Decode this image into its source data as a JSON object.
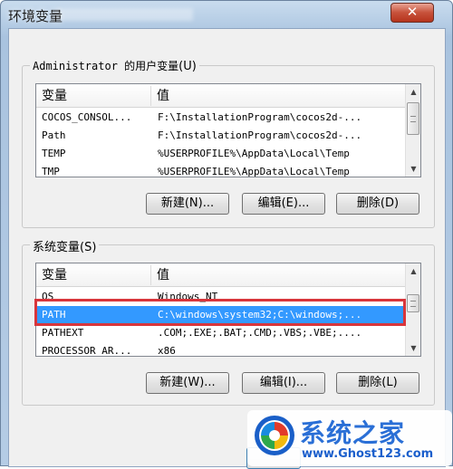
{
  "window": {
    "title": "环境变量",
    "close_label": "✕"
  },
  "user_vars": {
    "label": "Administrator 的用户变量",
    "label_key": "(U)",
    "col_var": "变量",
    "col_val": "值",
    "rows": [
      {
        "name": "COCOS_CONSOL...",
        "value": "F:\\InstallationProgram\\cocos2d-..."
      },
      {
        "name": "Path",
        "value": "F:\\InstallationProgram\\cocos2d-..."
      },
      {
        "name": "TEMP",
        "value": "%USERPROFILE%\\AppData\\Local\\Temp"
      },
      {
        "name": "TMP",
        "value": "%USERPROFILE%\\AppData\\Local\\Temp"
      }
    ],
    "buttons": {
      "new": "新建(N)...",
      "edit": "编辑(E)...",
      "delete": "删除(D)"
    }
  },
  "system_vars": {
    "label": "系统变量",
    "label_key": "(S)",
    "col_var": "变量",
    "col_val": "值",
    "rows": [
      {
        "name": "OS",
        "value": "Windows_NT"
      },
      {
        "name": "PATH",
        "value": "C:\\windows\\system32;C:\\windows;..."
      },
      {
        "name": "PATHEXT",
        "value": ".COM;.EXE;.BAT;.CMD;.VBS;.VBE;...."
      },
      {
        "name": "PROCESSOR_AR...",
        "value": "x86"
      }
    ],
    "selected_row": "PATH",
    "buttons": {
      "new": "新建(W)...",
      "edit": "编辑(I)...",
      "delete": "删除(L)"
    }
  },
  "watermark": {
    "title": "系统之家",
    "url": "www.Ghost123.com"
  },
  "colors": {
    "selection": "#3399ff",
    "highlight_box": "#d8363c",
    "watermark_blue": "#2a6fd6"
  }
}
